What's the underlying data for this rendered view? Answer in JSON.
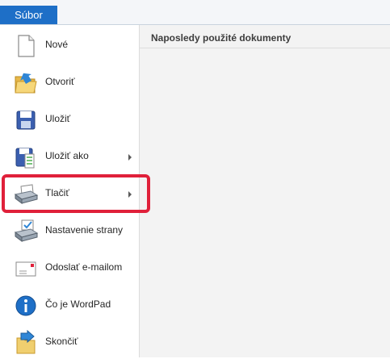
{
  "tab": {
    "label": "Súbor"
  },
  "recent_panel": {
    "title": "Naposledy použité dokumenty"
  },
  "menu": {
    "items": [
      {
        "label": "Nové",
        "icon": "new-document-icon",
        "submenu": false
      },
      {
        "label": "Otvoriť",
        "icon": "open-folder-icon",
        "submenu": false
      },
      {
        "label": "Uložiť",
        "icon": "save-disk-icon",
        "submenu": false
      },
      {
        "label": "Uložiť ako",
        "icon": "save-as-icon",
        "submenu": true
      },
      {
        "label": "Tlačiť",
        "icon": "printer-icon",
        "submenu": true,
        "highlighted": true
      },
      {
        "label": "Nastavenie strany",
        "icon": "page-setup-icon",
        "submenu": false
      },
      {
        "label": "Odoslať e-mailom",
        "icon": "email-envelope-icon",
        "submenu": false
      },
      {
        "label": "Čo je WordPad",
        "icon": "info-icon",
        "submenu": false
      },
      {
        "label": "Skončiť",
        "icon": "exit-icon",
        "submenu": false
      }
    ]
  },
  "colors": {
    "accent": "#1e6fc7",
    "highlight_border": "#e0203a"
  }
}
